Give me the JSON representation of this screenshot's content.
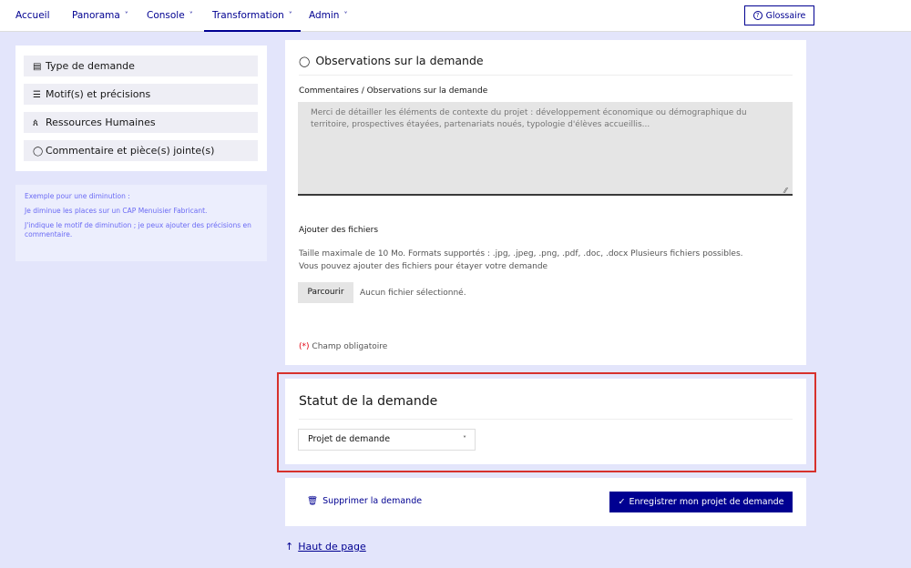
{
  "nav": {
    "items": [
      {
        "label": "Accueil",
        "has_menu": false
      },
      {
        "label": "Panorama",
        "has_menu": true
      },
      {
        "label": "Console",
        "has_menu": true
      },
      {
        "label": "Transformation",
        "has_menu": true,
        "active": true
      },
      {
        "label": "Admin",
        "has_menu": true
      }
    ],
    "chevron": "˅",
    "glossary_label": "Glossaire",
    "glossary_icon": "?"
  },
  "sidebar": {
    "items": [
      {
        "icon": "▤",
        "label": "Type de demande"
      },
      {
        "icon": "☰",
        "label": "Motif(s) et précisions"
      },
      {
        "icon": "ጰ",
        "label": "Ressources Humaines"
      },
      {
        "icon": "◯",
        "label": "Commentaire et pièce(s) jointe(s)"
      }
    ],
    "help": {
      "title": "Exemple pour une diminution :",
      "line1": "Je diminue les places sur un CAP Menuisier Fabricant.",
      "line2": "J'indique le motif de diminution ; je peux ajouter des précisions en commentaire."
    }
  },
  "observations": {
    "title": "Observations sur la demande",
    "comment_label": "Commentaires / Observations sur la demande",
    "comment_placeholder": "Merci de détailler les éléments de contexte du projet : développement économique ou démographique du territoire, prospectives étayées, partenariats noués, typologie d'élèves accueillis...",
    "files_label": "Ajouter des fichiers",
    "files_hint1": "Taille maximale de 10 Mo. Formats supportés : .jpg, .jpeg, .png, .pdf, .doc, .docx Plusieurs fichiers possibles.",
    "files_hint2": "Vous pouvez ajouter des fichiers pour étayer votre demande",
    "browse_label": "Parcourir",
    "no_file": "Aucun fichier sélectionné.",
    "required_star": "(*)",
    "required_text": "Champ obligatoire"
  },
  "status": {
    "title": "Statut de la demande",
    "selected": "Projet de demande"
  },
  "actions": {
    "delete_label": "Supprimer la demande",
    "save_label": "Enregistrer mon projet de demande"
  },
  "footer": {
    "top_link": "Haut de page"
  },
  "colors": {
    "primary": "#000091",
    "background": "#e3e5fb",
    "highlight": "#d7312c",
    "required": "#e1000f"
  }
}
